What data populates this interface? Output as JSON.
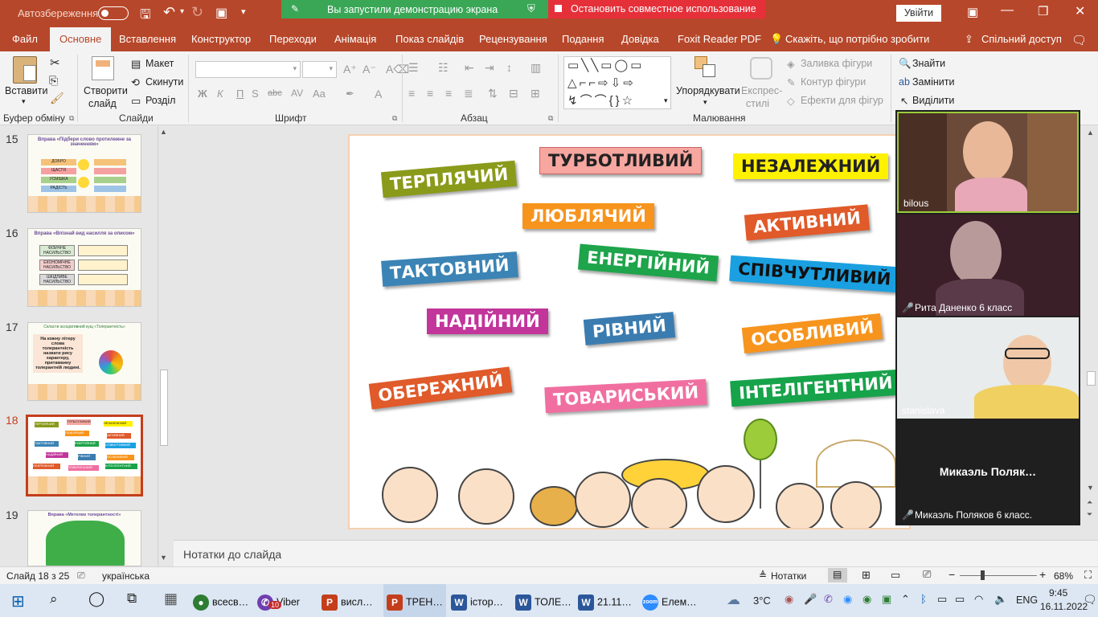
{
  "titlebar": {
    "autosave_label": "Автозбереження",
    "autosave_state": "Вимк",
    "share_banner": "Вы запустили демонстрацию экрана",
    "stop_share": "Остановить совместное использование",
    "signin": "Увійти"
  },
  "tabs": [
    "Файл",
    "Основне",
    "Вставлення",
    "Конструктор",
    "Переходи",
    "Анімація",
    "Показ слайдів",
    "Рецензування",
    "Подання",
    "Довідка",
    "Foxit Reader PDF"
  ],
  "tell_me": "Скажіть, що потрібно зробити",
  "share": "Спільний доступ",
  "ribbon": {
    "paste": "Вставити",
    "new_slide_1": "Створити",
    "new_slide_2": "слайд",
    "layout": "Макет",
    "reset": "Скинути",
    "section": "Розділ",
    "bold": "Ж",
    "italic": "К",
    "underline": "П",
    "strike": "abc",
    "arrange": "Упорядкувати",
    "quick_styles_1": "Експрес-",
    "quick_styles_2": "стилі",
    "shape_fill": "Заливка фігури",
    "shape_outline": "Контур фігури",
    "shape_effects": "Ефекти для фігур",
    "find": "Знайти",
    "replace": "Замінити",
    "select": "Виділити",
    "groups": {
      "clipboard": "Буфер обміну",
      "slides": "Слайди",
      "font": "Шрифт",
      "paragraph": "Абзац",
      "drawing": "Малювання"
    }
  },
  "thumbnails": [
    {
      "num": "15",
      "title": "Вправа «Підбери слово протилежне за значенням»",
      "rows": [
        "ДОБРО",
        "ЩАСТЯ",
        "УСМІШКА",
        "РАДІСТЬ"
      ]
    },
    {
      "num": "16",
      "title": "Вправа «Впізнай вид насилля за описом»",
      "rows": [
        "ФІЗИЧНЕ НАСИЛЬСТВО",
        "ЕКОНОМІЧНЕ НАСИЛЬСТВО",
        "ШКІДЛИВЕ НАСИЛЬСТВО"
      ]
    },
    {
      "num": "17",
      "title": "Скласти асоціативний кущ «Толерантність»",
      "body": "На кожну літеру слова толерантність назвати рису характеру, притаманну толерантній людині."
    },
    {
      "num": "18"
    },
    {
      "num": "19",
      "title": "Вправа «Метелик толерантності»"
    }
  ],
  "slide_words": [
    {
      "text": "ТЕРПЛЯЧИЙ",
      "bg": "#8a9a1a"
    },
    {
      "text": "ТУРБОТЛИВИЙ",
      "bg": "#f7a6a0"
    },
    {
      "text": "НЕЗАЛЕЖНИЙ",
      "bg": "#fff200"
    },
    {
      "text": "ЛЮБЛЯЧИЙ",
      "bg": "#f7941d"
    },
    {
      "text": "АКТИВНИЙ",
      "bg": "#e05a2a"
    },
    {
      "text": "ТАКТОВНИЙ",
      "bg": "#3b84b5"
    },
    {
      "text": "ЕНЕРГІЙНИЙ",
      "bg": "#1ea44a"
    },
    {
      "text": "СПІВЧУТЛИВИЙ",
      "bg": "#1aa0e0"
    },
    {
      "text": "НАДІЙНИЙ",
      "bg": "#c2359a"
    },
    {
      "text": "РІВНИЙ",
      "bg": "#3b7cb0"
    },
    {
      "text": "ОСОБЛИВИЙ",
      "bg": "#f7941d"
    },
    {
      "text": "ОБЕРЕЖНИЙ",
      "bg": "#e05a2a"
    },
    {
      "text": "ТОВАРИСЬКИЙ",
      "bg": "#f06fa0"
    },
    {
      "text": "ІНТЕЛІГЕНТНИЙ",
      "bg": "#17a34a"
    }
  ],
  "notes_placeholder": "Нотатки до слайда",
  "status": {
    "slide_of": "Слайд 18 з 25",
    "language": "українська",
    "notes": "Нотатки",
    "zoom": "68%"
  },
  "video": [
    {
      "name": "bilous"
    },
    {
      "name": "Рита Даненко 6 класс"
    },
    {
      "name": "stanislava"
    },
    {
      "name": "Микаэль Поляков 6 класс.",
      "big": "Микаэль  Поляк…"
    }
  ],
  "taskbar": {
    "items": [
      {
        "label": "всесв…",
        "icon": "chrome-icon",
        "color": "#2e7d32"
      },
      {
        "label": "Viber",
        "icon": "viber-icon",
        "color": "#6f3faf",
        "badge": "10"
      },
      {
        "label": "висл…",
        "icon": "powerpoint-icon",
        "color": "#c43e1c"
      },
      {
        "label": "ТРЕН…",
        "icon": "powerpoint-icon",
        "color": "#c43e1c"
      },
      {
        "label": "істор…",
        "icon": "word-icon",
        "color": "#2b579a"
      },
      {
        "label": "ТОЛЕ…",
        "icon": "word-icon",
        "color": "#2b579a"
      },
      {
        "label": "21.11…",
        "icon": "word-icon",
        "color": "#2b579a"
      },
      {
        "label": "Елем…",
        "icon": "zoom-icon",
        "color": "#2d8cff"
      }
    ],
    "zoom_icon_text": "zoom",
    "temp": "3°C",
    "lang": "ENG",
    "time": "9:45",
    "date": "16.11.2022"
  }
}
